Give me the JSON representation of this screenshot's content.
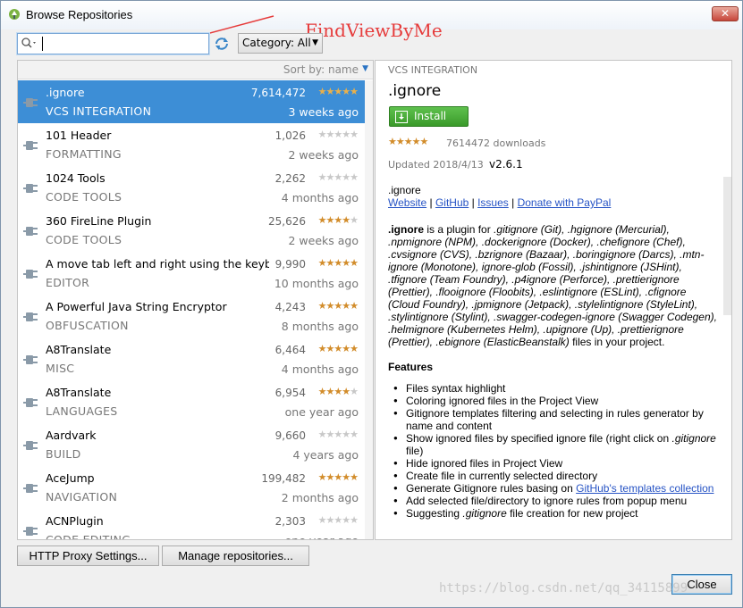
{
  "window": {
    "title": "Browse Repositories"
  },
  "annotation": {
    "text": "FindViewByMe"
  },
  "search": {
    "value": "",
    "placeholder": ""
  },
  "category": {
    "label": "Category: All"
  },
  "sort": {
    "label": "Sort by: name"
  },
  "colors": {
    "accent": "#3d8ed6",
    "install": "#4caf3c",
    "star": "#d28c2a",
    "link": "#2754c5"
  },
  "plugins": [
    {
      "name": ".ignore",
      "category": "VCS INTEGRATION",
      "downloads": "7,614,472",
      "rating": 4.5,
      "date": "3 weeks ago",
      "selected": true
    },
    {
      "name": "101 Header",
      "category": "FORMATTING",
      "downloads": "1,026",
      "rating": 0,
      "date": "2 weeks ago"
    },
    {
      "name": "1024 Tools",
      "category": "CODE TOOLS",
      "downloads": "2,262",
      "rating": 0,
      "date": "4 months ago"
    },
    {
      "name": "360 FireLine Plugin",
      "category": "CODE TOOLS",
      "downloads": "25,626",
      "rating": 4,
      "date": "2 weeks ago"
    },
    {
      "name": "A move tab left and right using the keyboard",
      "category": "EDITOR",
      "downloads": "9,990",
      "rating": 4.5,
      "date": "10 months ago"
    },
    {
      "name": "A Powerful Java String Encryptor",
      "category": "OBFUSCATION",
      "downloads": "4,243",
      "rating": 5,
      "date": "8 months ago"
    },
    {
      "name": "A8Translate",
      "category": "MISC",
      "downloads": "6,464",
      "rating": 5,
      "date": "4 months ago"
    },
    {
      "name": "A8Translate",
      "category": "LANGUAGES",
      "downloads": "6,954",
      "rating": 3.5,
      "date": "one year ago"
    },
    {
      "name": "Aardvark",
      "category": "BUILD",
      "downloads": "9,660",
      "rating": 0,
      "date": "4 years ago"
    },
    {
      "name": "AceJump",
      "category": "NAVIGATION",
      "downloads": "199,482",
      "rating": 4.5,
      "date": "2 months ago"
    },
    {
      "name": "ACNPlugin",
      "category": "CODE EDITING",
      "downloads": "2,303",
      "rating": 0,
      "date": "one year ago"
    }
  ],
  "detail": {
    "category": "VCS INTEGRATION",
    "name": ".ignore",
    "install_label": "Install",
    "rating": 4.5,
    "downloads_label": "7614472 downloads",
    "updated_label": "Updated 2018/4/13",
    "version": "v2.6.1",
    "short_name": ".ignore",
    "links": {
      "website": "Website",
      "github": "GitHub",
      "issues": "Issues",
      "donate": "Donate with PayPal",
      "sep": " | "
    },
    "desc_bold": ".ignore",
    "desc_intro": " is a plugin for ",
    "desc_list": ".gitignore (Git), .hgignore (Mercurial), .npmignore (NPM), .dockerignore (Docker), .chefignore (Chef), .cvsignore (CVS), .bzrignore (Bazaar), .boringignore (Darcs), .mtn-ignore (Monotone), ignore-glob (Fossil), .jshintignore (JSHint), .tfignore (Team Foundry), .p4ignore (Perforce), .prettierignore (Prettier), .flooignore (Floobits), .eslintignore (ESLint), .cfignore (Cloud Foundry), .jpmignore (Jetpack), .stylelintignore (StyleLint), .stylintignore (Stylint), .swagger-codegen-ignore (Swagger Codegen), .helmignore (Kubernetes Helm), .upignore (Up), .prettierignore (Prettier), .ebignore (ElasticBeanstalk)",
    "desc_end": " files in your project.",
    "features_title": "Features",
    "features": {
      "f1": "Files syntax highlight",
      "f2": "Coloring ignored files in the Project View",
      "f3": "Gitignore templates filtering and selecting in rules generator by name and content",
      "f4a": "Show ignored files by specified ignore file (right click on ",
      "f4b": ".gitignore",
      "f4c": " file)",
      "f5": "Hide ignored files in Project View",
      "f6": "Create file in currently selected directory",
      "f7a": "Generate Gitignore rules basing on ",
      "f7b": "GitHub's templates collection",
      "f8": "Add selected file/directory to ignore rules from popup menu",
      "f9a": "Suggesting ",
      "f9b": ".gitignore",
      "f9c": " file creation for new project"
    }
  },
  "buttons": {
    "proxy": "HTTP Proxy Settings...",
    "repos": "Manage repositories...",
    "close": "Close"
  },
  "watermark": "https://blog.csdn.net/qq_34115899"
}
